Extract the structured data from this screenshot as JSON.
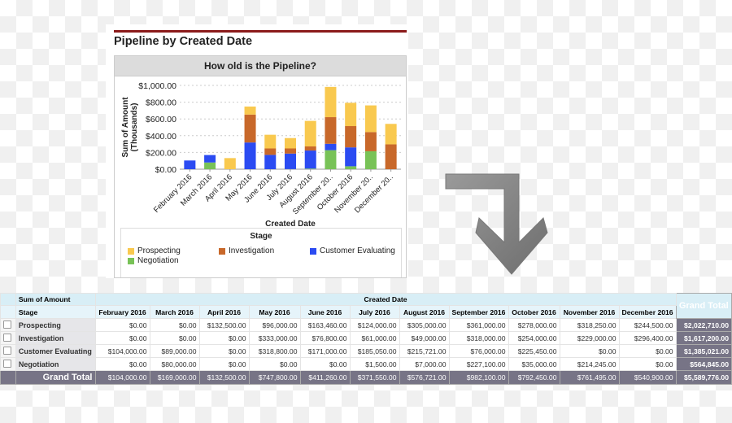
{
  "panel": {
    "title": "Pipeline by Created Date",
    "chart_header": "How old is the Pipeline?"
  },
  "chart_data": {
    "type": "bar",
    "stacked": true,
    "title": "How old is the Pipeline?",
    "xlabel": "Created Date",
    "ylabel": "Sum of Amount",
    "ylabel2": "(Thousands)",
    "categories": [
      "February 2016",
      "March 2016",
      "April 2016",
      "May 2016",
      "June 2016",
      "July 2016",
      "August 2016",
      "September 20..",
      "October 2016",
      "November 20..",
      "December 20.."
    ],
    "yticks": [
      "$0.00",
      "$200.00",
      "$400.00",
      "$600.00",
      "$800.00",
      "$1,000.00"
    ],
    "ylim": [
      0,
      1000
    ],
    "grid": true,
    "legend_title": "Stage",
    "legend_position": "bottom",
    "series": [
      {
        "name": "Negotiation",
        "color": "#78c257",
        "values": [
          0,
          80,
          0,
          0,
          0,
          1.5,
          7,
          227.1,
          35,
          214.245,
          0
        ]
      },
      {
        "name": "Customer Evaluating",
        "color": "#2b4bf2",
        "values": [
          104,
          89,
          0,
          318.8,
          171,
          185.05,
          215.721,
          76,
          225.45,
          0,
          0
        ]
      },
      {
        "name": "Investigation",
        "color": "#c8682a",
        "values": [
          0,
          0,
          0,
          333,
          76.8,
          61,
          49,
          318,
          254,
          229,
          296.4
        ]
      },
      {
        "name": "Prospecting",
        "color": "#f9c94f",
        "values": [
          0,
          0,
          132.5,
          96,
          163.46,
          124,
          305,
          361,
          278,
          318.25,
          244.5
        ]
      }
    ],
    "legend_order": [
      "Prospecting",
      "Investigation",
      "Customer Evaluating",
      "Negotiation"
    ]
  },
  "table": {
    "corner": "Sum of Amount",
    "col_group": "Created Date",
    "row_header": "Stage",
    "grand_total_label": "Grand Total",
    "columns": [
      "February 2016",
      "March 2016",
      "April 2016",
      "May 2016",
      "June 2016",
      "July 2016",
      "August 2016",
      "September 2016",
      "October 2016",
      "November 2016",
      "December 2016"
    ],
    "rows": [
      {
        "stage": "Prospecting",
        "values": [
          "$0.00",
          "$0.00",
          "$132,500.00",
          "$96,000.00",
          "$163,460.00",
          "$124,000.00",
          "$305,000.00",
          "$361,000.00",
          "$278,000.00",
          "$318,250.00",
          "$244,500.00"
        ],
        "total": "$2,022,710.00"
      },
      {
        "stage": "Investigation",
        "values": [
          "$0.00",
          "$0.00",
          "$0.00",
          "$333,000.00",
          "$76,800.00",
          "$61,000.00",
          "$49,000.00",
          "$318,000.00",
          "$254,000.00",
          "$229,000.00",
          "$296,400.00"
        ],
        "total": "$1,617,200.00"
      },
      {
        "stage": "Customer Evaluating",
        "values": [
          "$104,000.00",
          "$89,000.00",
          "$0.00",
          "$318,800.00",
          "$171,000.00",
          "$185,050.00",
          "$215,721.00",
          "$76,000.00",
          "$225,450.00",
          "$0.00",
          "$0.00"
        ],
        "total": "$1,385,021.00"
      },
      {
        "stage": "Negotiation",
        "values": [
          "$0.00",
          "$80,000.00",
          "$0.00",
          "$0.00",
          "$0.00",
          "$1,500.00",
          "$7,000.00",
          "$227,100.00",
          "$35,000.00",
          "$214,245.00",
          "$0.00"
        ],
        "total": "$564,845.00"
      }
    ],
    "grand_totals": [
      "$104,000.00",
      "$169,000.00",
      "$132,500.00",
      "$747,800.00",
      "$411,260.00",
      "$371,550.00",
      "$576,721.00",
      "$982,100.00",
      "$792,450.00",
      "$761,495.00",
      "$540,900.00"
    ],
    "grand_total_all": "$5,589,776.00"
  },
  "arrow": {
    "icon": "bent-arrow-down-icon",
    "color": "#8a8a8a"
  }
}
